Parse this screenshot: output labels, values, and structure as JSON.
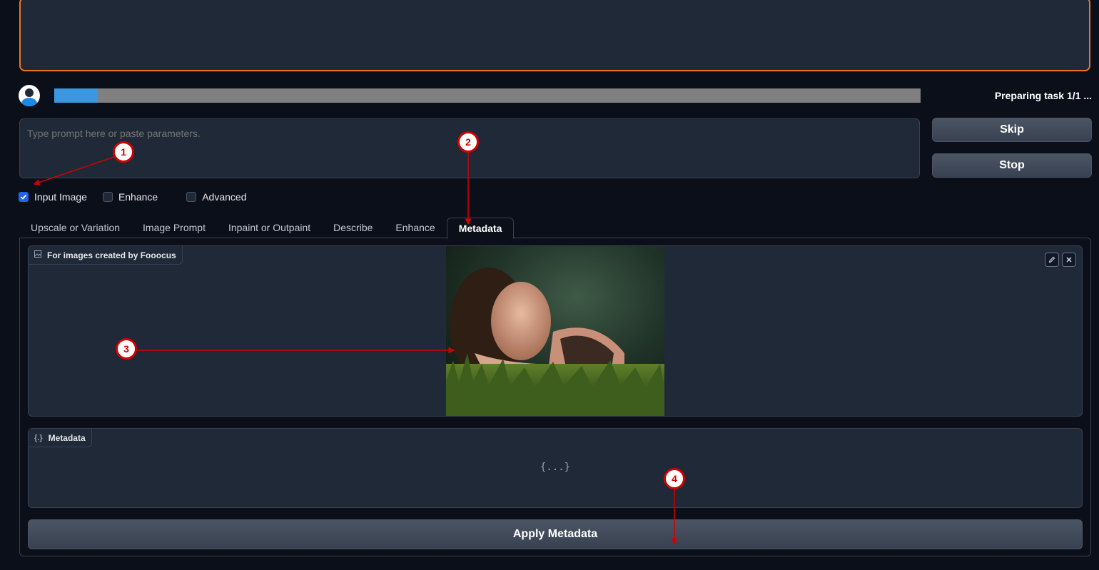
{
  "progress": {
    "value": 0.05,
    "status_text": "Preparing task 1/1 ..."
  },
  "prompt": {
    "placeholder": "Type prompt here or paste parameters.",
    "value": ""
  },
  "buttons": {
    "skip": "Skip",
    "stop": "Stop",
    "apply": "Apply Metadata"
  },
  "options": [
    {
      "label": "Input Image",
      "checked": true
    },
    {
      "label": "Enhance",
      "checked": false
    },
    {
      "label": "Advanced",
      "checked": false
    }
  ],
  "tabs": [
    {
      "label": "Upscale or Variation",
      "active": false
    },
    {
      "label": "Image Prompt",
      "active": false
    },
    {
      "label": "Inpaint or Outpaint",
      "active": false
    },
    {
      "label": "Describe",
      "active": false
    },
    {
      "label": "Enhance",
      "active": false
    },
    {
      "label": "Metadata",
      "active": true
    }
  ],
  "image_panel": {
    "label": "For images created by Fooocus"
  },
  "metadata_panel": {
    "label": "Metadata",
    "empty_text": "{...}"
  },
  "annotations": [
    "1",
    "2",
    "3",
    "4"
  ],
  "colors": {
    "accent": "#e8762a",
    "progress_fill": "#3b97e0",
    "marker": "#d40000",
    "checkbox": "#2563eb"
  },
  "icons": [
    "user-avatar-icon",
    "image-icon",
    "json-icon",
    "edit-icon",
    "close-icon",
    "check-icon"
  ]
}
